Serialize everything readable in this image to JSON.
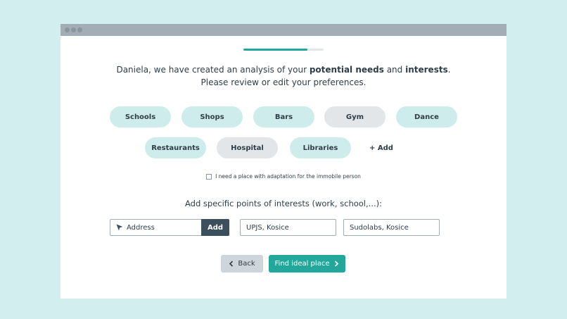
{
  "window": {
    "titlebar_dots": 3
  },
  "progress": {
    "fraction": 0.8
  },
  "intro": {
    "line1_prefix": "Daniela, we have created an analysis of your ",
    "needs": "potential needs",
    "and": " and ",
    "interests": "interests",
    "period": ".",
    "line2": "Please review or edit your preferences."
  },
  "chips": {
    "row1": [
      {
        "label": "Schools",
        "selected": true
      },
      {
        "label": "Shops",
        "selected": true
      },
      {
        "label": "Bars",
        "selected": true
      },
      {
        "label": "Gym",
        "selected": false
      },
      {
        "label": "Dance",
        "selected": true
      }
    ],
    "row2": [
      {
        "label": "Restaurants",
        "selected": true
      },
      {
        "label": "Hospital",
        "selected": false
      },
      {
        "label": "Libraries",
        "selected": true
      }
    ],
    "add_label": "+ Add"
  },
  "accessibility": {
    "label": "I need a place with adaptation for the immobile person",
    "checked": false
  },
  "poi": {
    "label": "Add specific points of interests (work, school,...):",
    "address_placeholder": "Address",
    "add_button": "Add",
    "entries": [
      "UPJS, Kosice",
      "Sudolabs, Kosice"
    ]
  },
  "nav": {
    "back_label": "Back",
    "find_label": "Find ideal place"
  },
  "colors": {
    "accent": "#22a79a",
    "chip_selected": "#cfecec",
    "chip_unselected": "#e3e6e8",
    "dark": "#3c4f5c",
    "background": "#d2eeee"
  }
}
